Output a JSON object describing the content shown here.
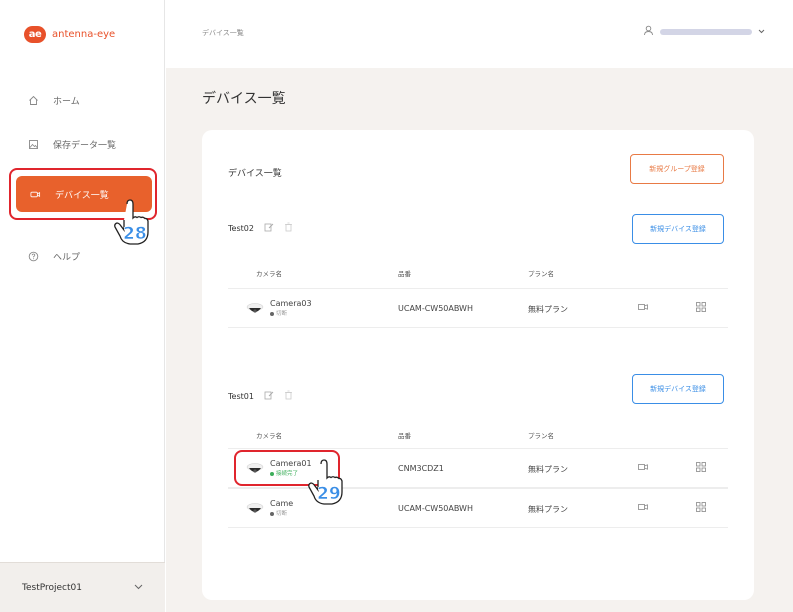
{
  "brand": {
    "logo_mark": "ae",
    "name": "antenna-eye"
  },
  "sidebar": {
    "items": [
      {
        "label": "ホーム",
        "icon": "home-icon"
      },
      {
        "label": "保存データ一覧",
        "icon": "image-icon"
      },
      {
        "label": "デバイス一覧",
        "icon": "camera-icon"
      },
      {
        "label": "ヘルプ",
        "icon": "help-icon"
      }
    ],
    "project": "TestProject01"
  },
  "topbar": {
    "breadcrumb": "デバイス一覧"
  },
  "main": {
    "page_title": "デバイス一覧",
    "card_title": "デバイス一覧",
    "new_group_button": "新規グループ登録",
    "columns": {
      "camera": "カメラ名",
      "model": "品番",
      "plan": "プラン名"
    },
    "groups": [
      {
        "name": "Test02",
        "new_device_button": "新規デバイス登録",
        "rows": [
          {
            "camera": "Camera03",
            "status": "切断",
            "status_color": "#666666",
            "model": "UCAM-CW50ABWH",
            "plan": "無料プラン"
          }
        ]
      },
      {
        "name": "Test01",
        "new_device_button": "新規デバイス登録",
        "rows": [
          {
            "camera": "Camera01",
            "status": "接続完了",
            "status_color": "#3cae5a",
            "model": "CNM3CDZ1",
            "plan": "無料プラン"
          },
          {
            "camera": "Came",
            "status": "切断",
            "status_color": "#666666",
            "model": "UCAM-CW50ABWH",
            "plan": "無料プラン"
          }
        ]
      }
    ]
  },
  "callouts": {
    "step_28": "28",
    "step_29": "29"
  },
  "colors": {
    "accent": "#e8612c",
    "highlight": "#e0252d",
    "link_blue": "#3a8ee6"
  }
}
